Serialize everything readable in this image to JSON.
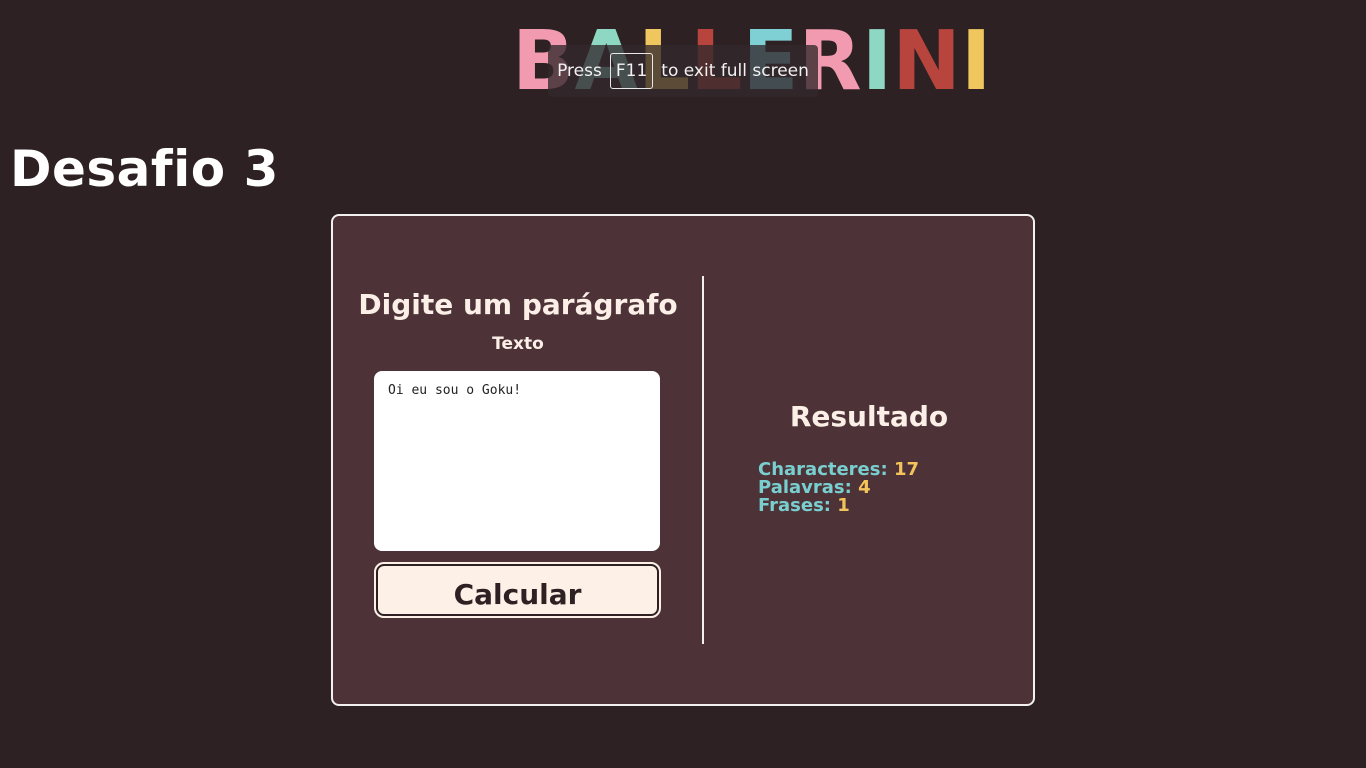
{
  "logo": {
    "letters": [
      {
        "char": "B",
        "color": "#f29bb0"
      },
      {
        "char": "A",
        "color": "#8ed8c3"
      },
      {
        "char": "L",
        "color": "#f0c75e"
      },
      {
        "char": "L",
        "color": "#b8453d"
      },
      {
        "char": "E",
        "color": "#7fd0d4"
      },
      {
        "char": "R",
        "color": "#f29bb0"
      },
      {
        "char": "I",
        "color": "#8ed8c3"
      },
      {
        "char": "N",
        "color": "#b8453d"
      },
      {
        "char": "I",
        "color": "#f0c75e"
      }
    ]
  },
  "fullscreen_notice": {
    "prefix": "Press",
    "key": "F11",
    "suffix": "to exit full screen"
  },
  "page": {
    "title": "Desafio 3"
  },
  "input_panel": {
    "heading": "Digite um parágrafo",
    "label": "Texto",
    "text_value": "Oi eu sou o Goku!",
    "button_label": "Calcular"
  },
  "result_panel": {
    "title": "Resultado",
    "stats": [
      {
        "label": "Characteres:",
        "value": "17"
      },
      {
        "label": "Palavras:",
        "value": "4"
      },
      {
        "label": "Frases:",
        "value": "1"
      }
    ]
  },
  "colors": {
    "background": "#2e2124",
    "card": "#4d3337",
    "stat_label": "#79cfd0",
    "stat_value": "#f3c45b"
  }
}
